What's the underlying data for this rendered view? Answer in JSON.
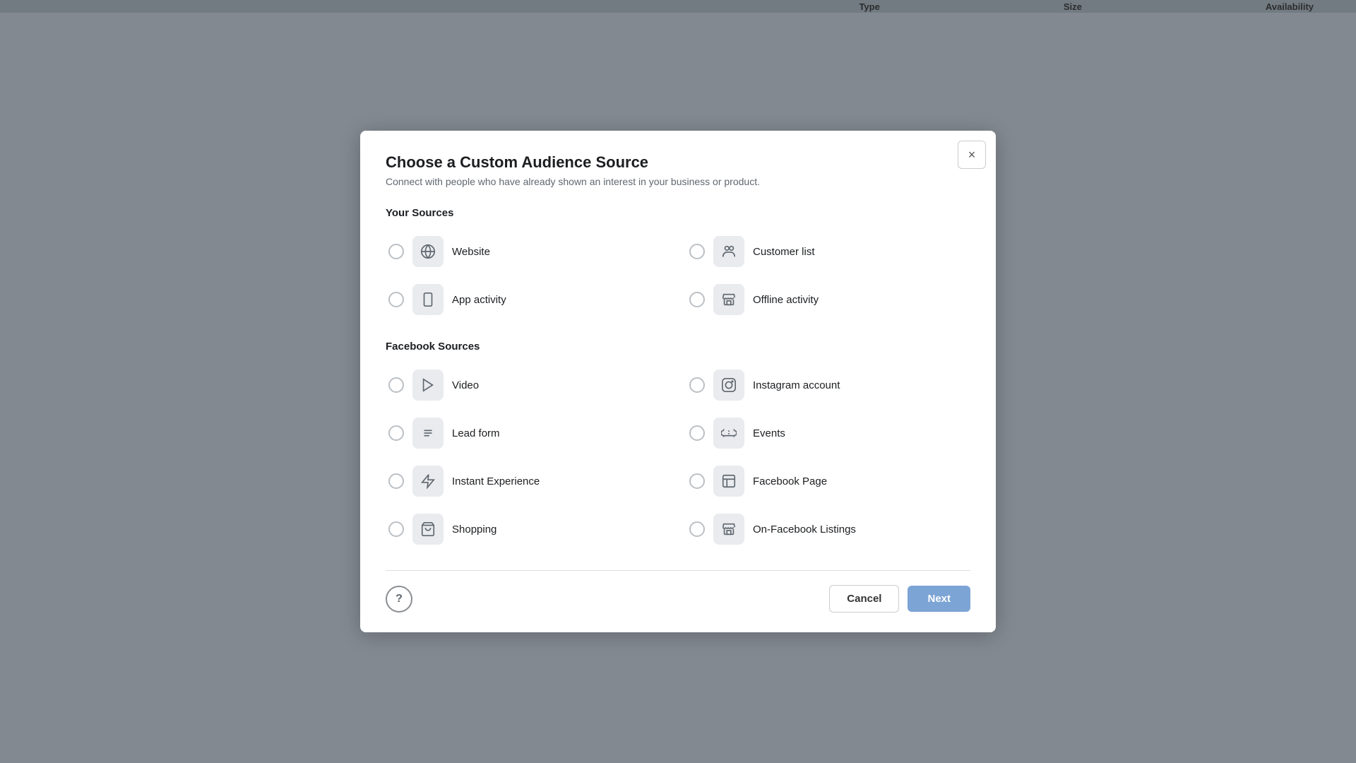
{
  "background": {
    "table_header": {
      "type_label": "Type",
      "size_label": "Size",
      "availability_label": "Availability"
    }
  },
  "dialog": {
    "title": "Choose a Custom Audience Source",
    "subtitle": "Connect with people who have already shown an interest in your business or product.",
    "close_label": "×",
    "your_sources_label": "Your Sources",
    "facebook_sources_label": "Facebook Sources",
    "your_sources": [
      {
        "id": "website",
        "label": "Website",
        "icon": "globe"
      },
      {
        "id": "customer-list",
        "label": "Customer list",
        "icon": "people"
      },
      {
        "id": "app-activity",
        "label": "App activity",
        "icon": "mobile"
      },
      {
        "id": "offline-activity",
        "label": "Offline activity",
        "icon": "store"
      }
    ],
    "facebook_sources": [
      {
        "id": "video",
        "label": "Video",
        "icon": "play"
      },
      {
        "id": "instagram",
        "label": "Instagram account",
        "icon": "instagram"
      },
      {
        "id": "lead-form",
        "label": "Lead form",
        "icon": "list"
      },
      {
        "id": "events",
        "label": "Events",
        "icon": "ticket"
      },
      {
        "id": "instant-experience",
        "label": "Instant Experience",
        "icon": "bolt"
      },
      {
        "id": "facebook-page",
        "label": "Facebook Page",
        "icon": "fb-page"
      },
      {
        "id": "shopping",
        "label": "Shopping",
        "icon": "cart"
      },
      {
        "id": "on-facebook-listings",
        "label": "On-Facebook Listings",
        "icon": "store2"
      }
    ],
    "footer": {
      "help_label": "?",
      "cancel_label": "Cancel",
      "next_label": "Next"
    }
  }
}
